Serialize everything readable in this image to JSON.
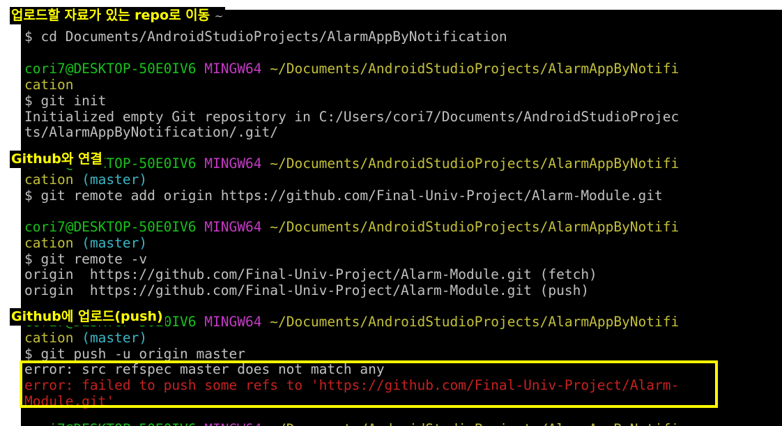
{
  "annotations": {
    "repo_move": "업로드할 자료가 있는 repo로 이동",
    "repo_tilde": "~",
    "github_link": "Github와 연결",
    "github_push": "Github에 업로드(push)"
  },
  "terminal": {
    "prompt": {
      "user_host": "cori7@DESKTOP-50E0IV6",
      "shell": "MINGW64",
      "path_part1": "~/Documents/AndroidStudioProjects/AlarmAppByNotifi",
      "path_part2": "cation",
      "branch": "(master)"
    },
    "lines": {
      "cmd_cd": "$ cd Documents/AndroidStudioProjects/AlarmAppByNotification",
      "cmd_init": "$ git init",
      "out_init_1": "Initialized empty Git repository in C:/Users/cori7/Documents/AndroidStudioProjec",
      "out_init_2": "ts/AlarmAppByNotification/.git/",
      "cmd_remote_add": "$ git remote add origin https://github.com/Final-Univ-Project/Alarm-Module.git",
      "cmd_remote_v": "$ git remote -v",
      "out_remote_fetch": "origin  https://github.com/Final-Univ-Project/Alarm-Module.git (fetch)",
      "out_remote_push": "origin  https://github.com/Final-Univ-Project/Alarm-Module.git (push)",
      "cmd_push": "$ git push -u origin master",
      "err_1": "error: src refspec master does not match any",
      "err_2": "error: failed to push some refs to 'https://github.com/Final-Univ-Project/Alarm-",
      "err_3": "Module.git'"
    }
  },
  "colors": {
    "user_host": "#17c21b",
    "shell": "#c53ac5",
    "path": "#c3c03a",
    "branch": "#3ab6c5",
    "text": "#c0c0c0",
    "error": "#c72121",
    "annotation": "#ffff00"
  }
}
